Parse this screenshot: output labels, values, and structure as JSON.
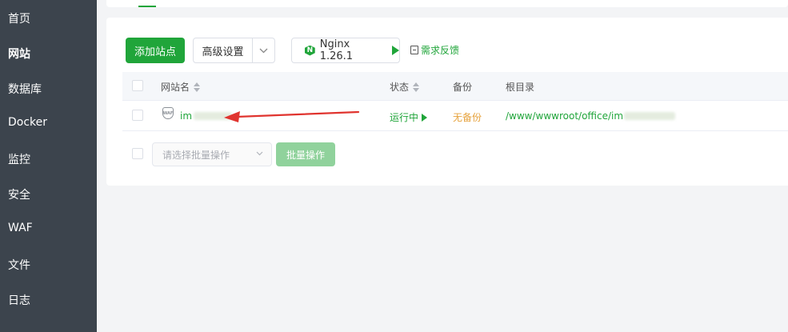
{
  "sidebar": {
    "items": [
      {
        "label": "首页",
        "active": false
      },
      {
        "label": "网站",
        "active": true
      },
      {
        "label": "数据库",
        "active": false
      },
      {
        "label": "Docker",
        "active": false
      },
      {
        "label": "监控",
        "active": false
      },
      {
        "label": "安全",
        "active": false
      },
      {
        "label": "WAF",
        "active": false
      },
      {
        "label": "文件",
        "active": false
      },
      {
        "label": "日志",
        "active": false
      }
    ]
  },
  "toolbar": {
    "add_site": "添加站点",
    "advanced": "高级设置",
    "nginx": "Nginx 1.26.1",
    "feedback": "需求反馈"
  },
  "table": {
    "columns": [
      "网站名",
      "状态",
      "备份",
      "根目录"
    ],
    "rows": [
      {
        "name": "im",
        "waf": "WAF",
        "status": "运行中",
        "backup": "无备份",
        "root": "/www/wwwroot/office/im"
      }
    ]
  },
  "batch": {
    "placeholder": "请选择批量操作",
    "button": "批量操作"
  },
  "colors": {
    "accent": "#20a53a",
    "sidebar_bg": "#3c444d",
    "backup_warn": "#e6a23c",
    "annotation_arrow": "#e0342f"
  }
}
